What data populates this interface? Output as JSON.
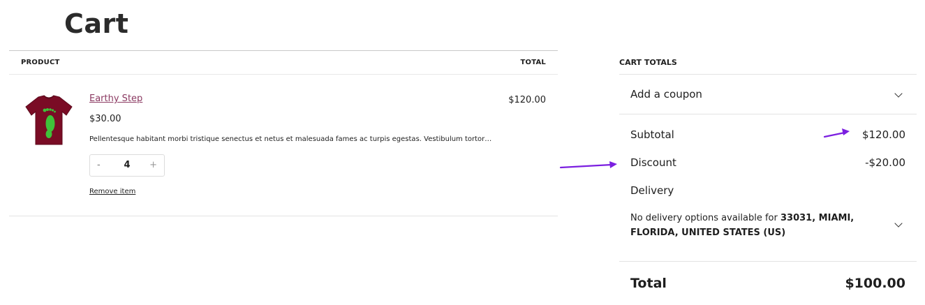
{
  "page": {
    "title": "Cart"
  },
  "cart_table": {
    "headers": {
      "product": "PRODUCT",
      "total": "TOTAL"
    },
    "items": [
      {
        "name": "Earthy Step",
        "price": "$30.00",
        "description": "Pellentesque habitant morbi tristique senectus et netus et malesuada fames ac turpis egestas. Vestibulum tortor…",
        "quantity": "4",
        "quantity_minus": "-",
        "quantity_plus": "+",
        "remove_label": "Remove item",
        "line_total": "$120.00",
        "thumbnail_icon": "tshirt-footprint-icon"
      }
    ]
  },
  "totals": {
    "title": "CART TOTALS",
    "coupon_label": "Add a coupon",
    "subtotal_label": "Subtotal",
    "subtotal_value": "$120.00",
    "discount_label": "Discount",
    "discount_value": "-$20.00",
    "delivery_label": "Delivery",
    "delivery_note_prefix": "No delivery options available for ",
    "delivery_note_location": "33031, MIAMI, FLORIDA, UNITED STATES (US)",
    "total_label": "Total",
    "total_value": "$100.00"
  },
  "colors": {
    "link": "#8b3a62",
    "annotation_arrow": "#7b1fe0",
    "shirt": "#7a0c25",
    "footprint": "#3fc23a"
  }
}
